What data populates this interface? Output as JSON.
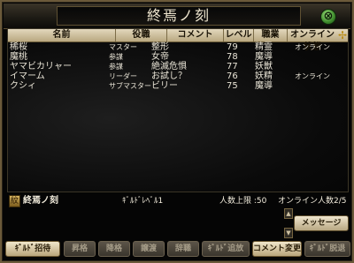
{
  "window": {
    "title": "終焉ノ刻"
  },
  "columns": [
    {
      "label": "名前"
    },
    {
      "label": "役職"
    },
    {
      "label": "コメント"
    },
    {
      "label": "レベル"
    },
    {
      "label": "職業"
    },
    {
      "label": "オンライン状態"
    }
  ],
  "members": [
    {
      "name": "稀桜",
      "role": "マスター",
      "comment": "整形",
      "level": "79",
      "job": "精霊",
      "status": "オンライン"
    },
    {
      "name": "魔桃",
      "role": "参謀",
      "comment": "女帝",
      "level": "78",
      "job": "魔導",
      "status": ""
    },
    {
      "name": "ヤマビカリャー",
      "role": "参謀",
      "comment": "絶滅危惧",
      "level": "77",
      "job": "妖獣",
      "status": ""
    },
    {
      "name": "イマーム",
      "role": "リーダー",
      "comment": "お試し？",
      "level": "76",
      "job": "妖精",
      "status": "オンライン"
    },
    {
      "name": "クシィ",
      "role": "サブマスター",
      "comment": "ビリー",
      "level": "75",
      "job": "魔導",
      "status": ""
    }
  ],
  "guild_info": {
    "name": "終焉ノ刻",
    "guild_level": "ｷﾞﾙﾄﾞﾚﾍﾞﾙ1",
    "member_limit": "人数上限 :50",
    "online_count": "オンライン人数2/5"
  },
  "buttons": {
    "message": "メッセージ",
    "invite": "ｷﾞﾙﾄﾞ招待",
    "promote": "昇格",
    "demote": "降格",
    "transfer": "譲渡",
    "resign": "辞職",
    "expel": "ｷﾞﾙﾄﾞ追放",
    "edit_comment": "コメント変更",
    "leave": "ｷﾞﾙﾄﾞ脱退"
  },
  "icons": {
    "close": "close-icon",
    "sort": "sort-icon",
    "emblem": "guild-emblem-icon",
    "scroll_up": "arrow-up-icon",
    "scroll_down": "arrow-down-icon"
  },
  "colors": {
    "header_bg": "#d4c7a8",
    "active_button": "#e8dcc0",
    "disabled_button": "#4d473c",
    "close_green": "#5fb84a",
    "text": "#e9e4d6"
  }
}
